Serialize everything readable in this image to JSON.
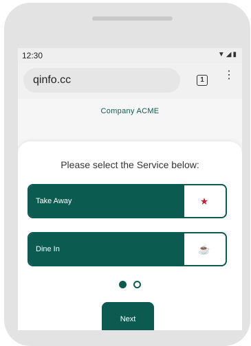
{
  "status_bar": {
    "time": "12:30",
    "icons": "▼◢▮"
  },
  "browser": {
    "url": "qinfo.cc",
    "tab_count": "1",
    "menu_glyph": "⋮"
  },
  "page": {
    "company": "Company ACME",
    "prompt": "Please select the Service below:",
    "services": [
      {
        "label": "Take Away",
        "icon": "star-icon",
        "glyph": "★"
      },
      {
        "label": "Dine In",
        "icon": "coffee-cup-icon",
        "glyph": "☕"
      }
    ],
    "pagination": {
      "current": 1,
      "total": 2
    },
    "next_label": "Next"
  },
  "colors": {
    "brand": "#0b5b50",
    "icon_accent": "#c21f35"
  }
}
